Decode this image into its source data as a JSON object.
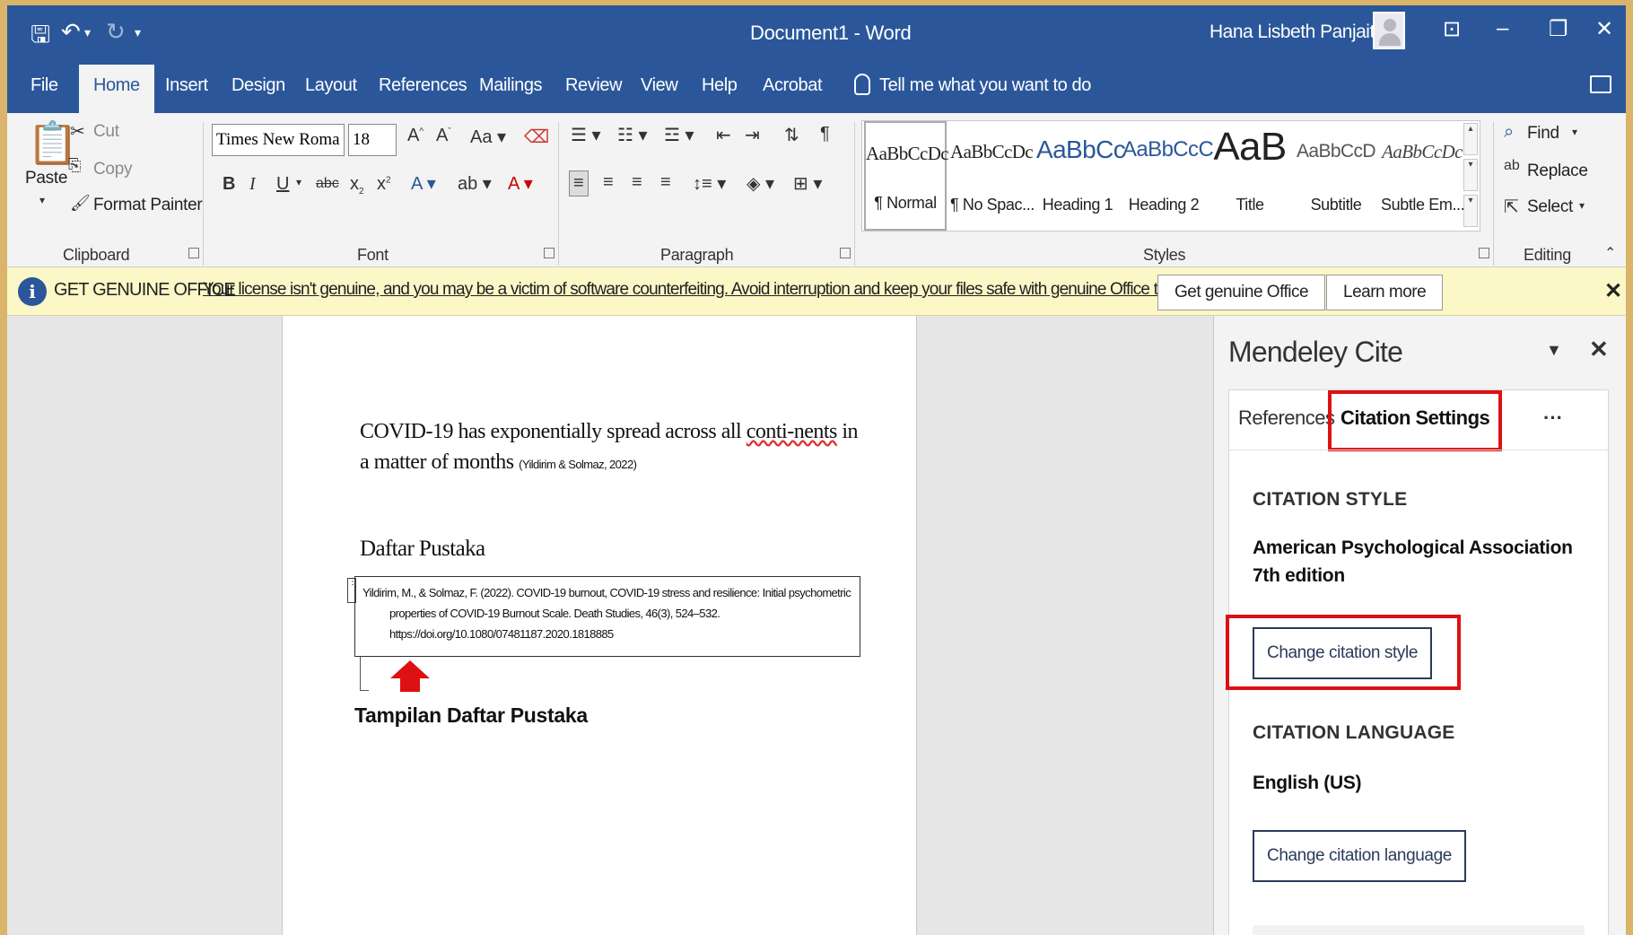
{
  "titlebar": {
    "doc_title": "Document1 - Word",
    "user_name": "Hana Lisbeth Panjaitan"
  },
  "tabs": [
    {
      "label": "File"
    },
    {
      "label": "Home"
    },
    {
      "label": "Insert"
    },
    {
      "label": "Design"
    },
    {
      "label": "Layout"
    },
    {
      "label": "References"
    },
    {
      "label": "Mailings"
    },
    {
      "label": "Review"
    },
    {
      "label": "View"
    },
    {
      "label": "Help"
    },
    {
      "label": "Acrobat"
    }
  ],
  "tell_me": "Tell me what you want to do",
  "ribbon": {
    "clipboard": {
      "paste": "Paste",
      "cut": "Cut",
      "copy": "Copy",
      "format_painter": "Format Painter",
      "group": "Clipboard"
    },
    "font": {
      "name": "Times New Roma",
      "size": "18",
      "group": "Font"
    },
    "paragraph": {
      "group": "Paragraph"
    },
    "styles": {
      "group": "Styles",
      "items": [
        {
          "sample": "AaBbCcDc",
          "name": "¶ Normal"
        },
        {
          "sample": "AaBbCcDc",
          "name": "¶ No Spac..."
        },
        {
          "sample": "AaBbCc",
          "name": "Heading 1"
        },
        {
          "sample": "AaBbCcC",
          "name": "Heading 2"
        },
        {
          "sample": "AaB",
          "name": "Title"
        },
        {
          "sample": "AaBbCcD",
          "name": "Subtitle"
        },
        {
          "sample": "AaBbCcDc",
          "name": "Subtle Em..."
        }
      ]
    },
    "editing": {
      "find": "Find",
      "replace": "Replace",
      "select": "Select",
      "group": "Editing"
    }
  },
  "banner": {
    "title": "GET GENUINE OFFICE",
    "message": "Your license isn't genuine, and you may be a victim of software counterfeiting. Avoid interruption and keep your files safe with genuine Office today.",
    "btn_genuine": "Get genuine Office",
    "btn_learn": "Learn more"
  },
  "document": {
    "body_start": "COVID-19 has exponentially spread across all ",
    "body_squiggle": "conti-nents",
    "body_mid": " in a matter of months ",
    "inline_citation": "(Yildirim & Solmaz, 2022)",
    "heading": "Daftar Pustaka",
    "ref_line1": "Yildirim, M., & Solmaz, F. (2022). COVID-19 burnout, COVID-19 stress and resilience: Initial psychometric",
    "ref_line2": "properties of COVID-19 Burnout Scale. Death Studies, 46(3), 524–532.",
    "ref_line3": "https://doi.org/10.1080/07481187.2020.1818885",
    "caption": "Tampilan Daftar Pustaka"
  },
  "mendeley": {
    "title": "Mendeley Cite",
    "tab_references": "References",
    "tab_settings": "Citation Settings",
    "more": "···",
    "style_label": "CITATION STYLE",
    "style_value": "American Psychological Association 7th edition",
    "change_style_btn": "Change citation style",
    "language_label": "CITATION LANGUAGE",
    "language_value": "English (US)",
    "change_language_btn": "Change citation language"
  },
  "colors": {
    "word_blue": "#2b579a",
    "highlight_red": "#dd1111",
    "banner_yellow": "#fcf7c7"
  }
}
